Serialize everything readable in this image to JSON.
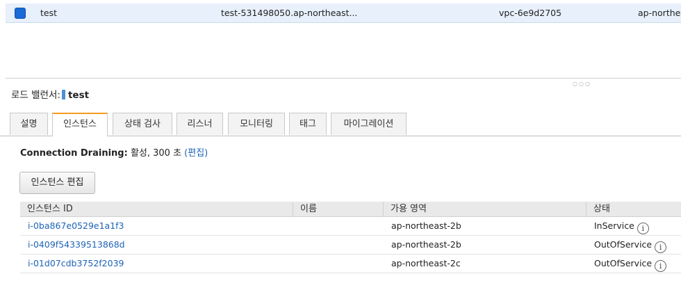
{
  "load_balancer_row": {
    "name": "test",
    "dns_name": "test-531498050.ap-northeast...",
    "vpc": "vpc-6e9d2705",
    "zone": "ap-northea"
  },
  "detail": {
    "label": "로드 밸런서:",
    "name": "test"
  },
  "tabs": [
    {
      "label": "설명"
    },
    {
      "label": "인스턴스"
    },
    {
      "label": "상태 검사"
    },
    {
      "label": "리스너"
    },
    {
      "label": "모니터링"
    },
    {
      "label": "태그"
    },
    {
      "label": "마이그레이션"
    }
  ],
  "connection_draining": {
    "label": "Connection Draining:",
    "value": "활성, 300 초",
    "edit_link": "(편집)"
  },
  "edit_instances_button": "인스턴스 편집",
  "instances_table": {
    "headers": [
      "인스턴스 ID",
      "이름",
      "가용 영역",
      "상태"
    ],
    "rows": [
      {
        "id": "i-0ba867e0529e1a1f3",
        "name": "",
        "zone": "ap-northeast-2b",
        "status": "InService"
      },
      {
        "id": "i-0409f54339513868d",
        "name": "",
        "zone": "ap-northeast-2b",
        "status": "OutOfService"
      },
      {
        "id": "i-01d07cdb3752f2039",
        "name": "",
        "zone": "ap-northeast-2c",
        "status": "OutOfService"
      }
    ]
  },
  "colors": {
    "accent_tab": "#f29b1d",
    "link": "#1d62b5",
    "selected_row": "#e7f0fb"
  },
  "icons": {
    "info": "info-circle-icon",
    "checkbox": "checkbox-checked-icon"
  }
}
